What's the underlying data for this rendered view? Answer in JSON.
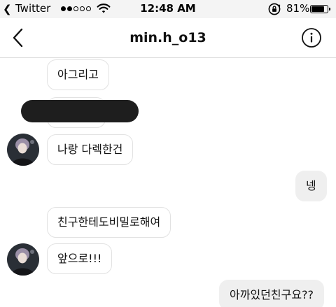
{
  "status_bar": {
    "back_app": "Twitter",
    "time": "12:48 AM",
    "battery": "81%",
    "battery_level": 0.81,
    "signal_bars_filled": 2,
    "signal_bars_total": 5
  },
  "header": {
    "title": "min.h_o13"
  },
  "messages": [
    {
      "side": "received",
      "text": "아그리고"
    },
    {
      "side": "received",
      "text": "",
      "redacted": true
    },
    {
      "side": "received",
      "text": "나랑 다렉한건",
      "avatar": true
    },
    {
      "side": "sent",
      "text": "넹"
    },
    {
      "side": "received",
      "text": "친구한테도비밀로해여"
    },
    {
      "side": "received",
      "text": "앞으로!!!",
      "avatar": true
    },
    {
      "side": "sent",
      "text": "아까있던친구요??"
    }
  ],
  "icons": {
    "back_app": "chevron-left-icon",
    "wifi": "wifi-icon",
    "lock": "orientation-lock-icon",
    "battery": "battery-icon",
    "nav_back": "chevron-left-icon",
    "info": "info-icon"
  }
}
